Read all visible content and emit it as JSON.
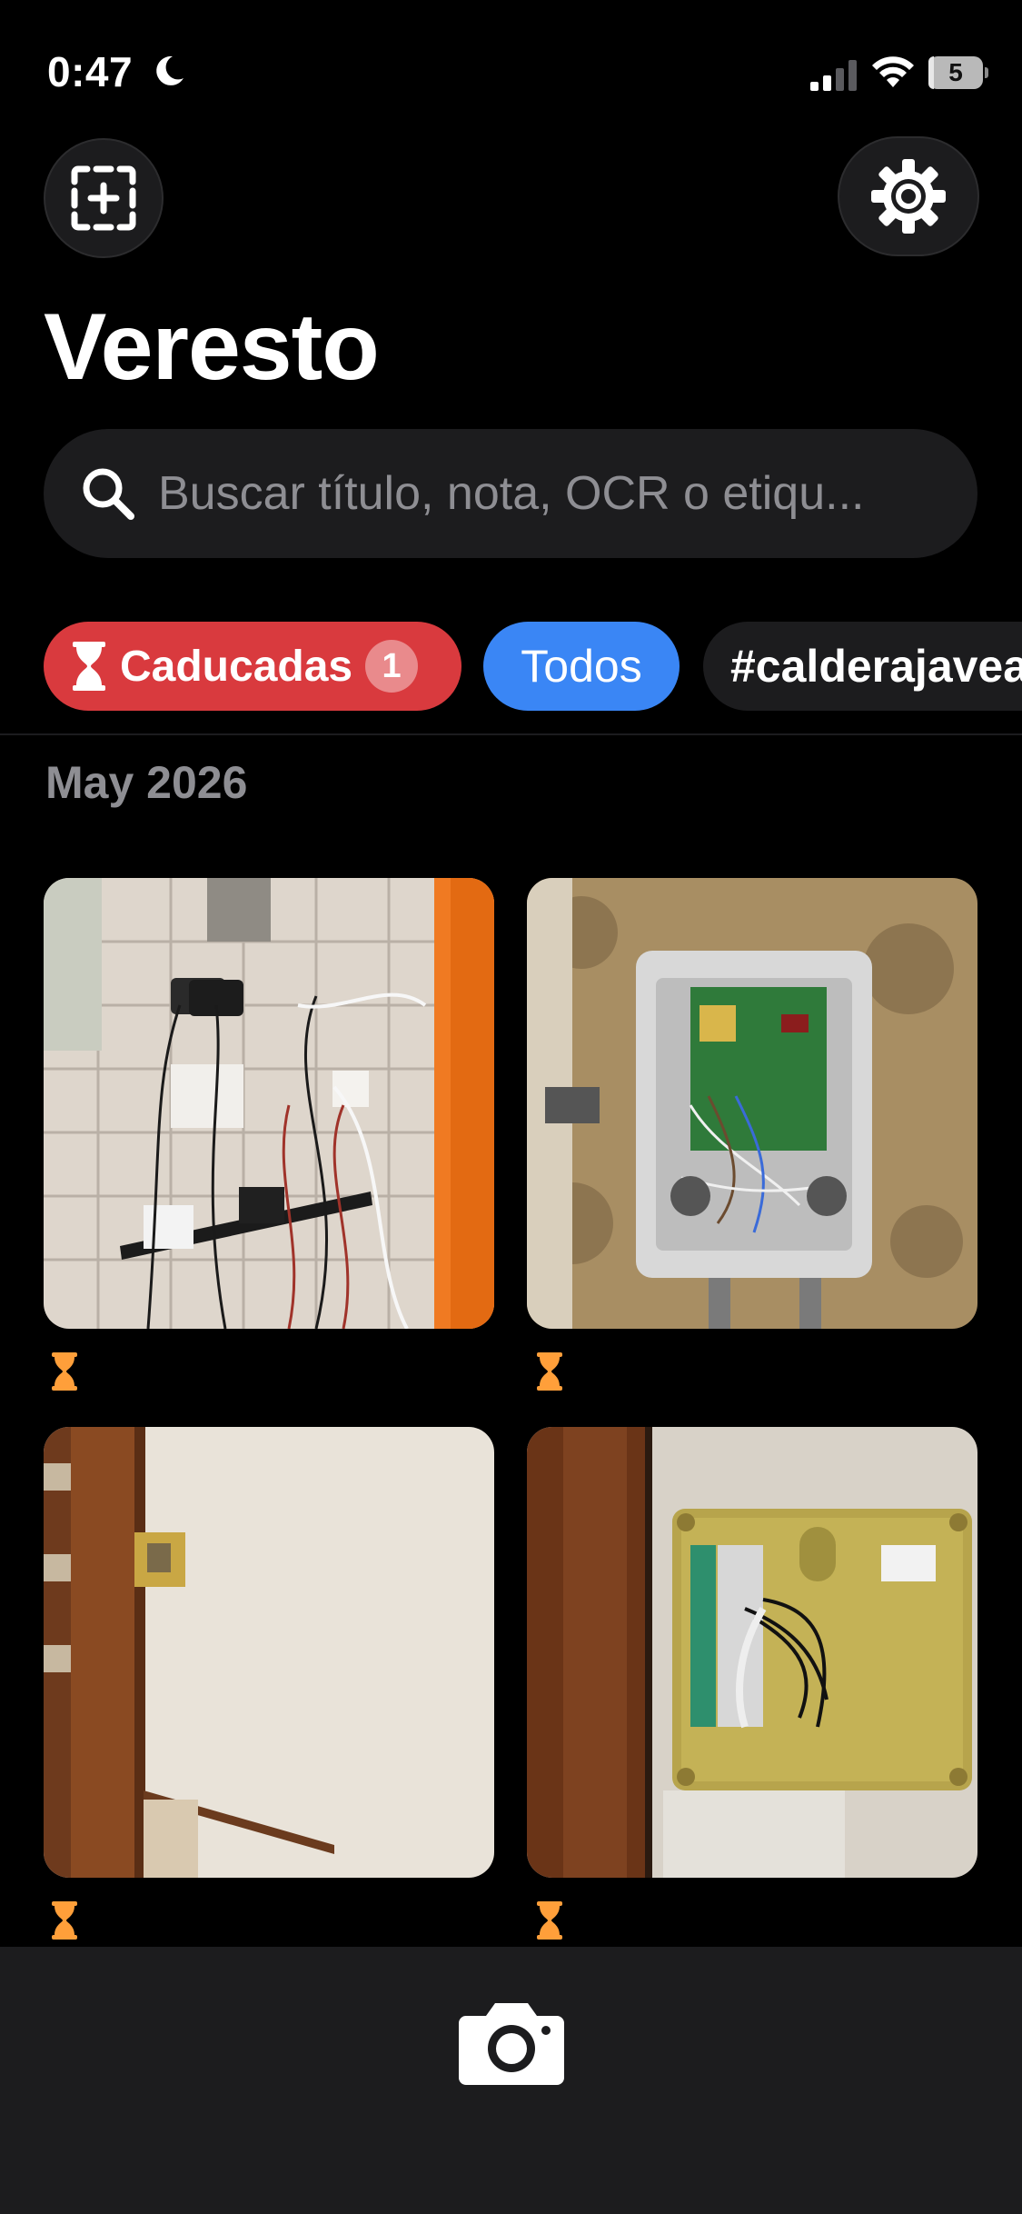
{
  "status_bar": {
    "time": "0:47",
    "battery": "5",
    "battery_level": 0.05,
    "icons": [
      "moon-icon",
      "signal-icon",
      "wifi-icon",
      "battery-icon"
    ]
  },
  "header": {
    "title": "Veresto",
    "left_button_icon": "add-frame-icon",
    "right_button_icon": "gear-icon"
  },
  "search": {
    "placeholder": "Buscar título, nota, OCR o etiqu..."
  },
  "filters": {
    "expired": {
      "label": "Caducadas",
      "count": "1",
      "icon": "hourglass-icon",
      "color": "#d93a3e"
    },
    "all": {
      "label": "Todos",
      "color": "#3a86f5"
    },
    "tag": {
      "label": "#calderajavea"
    }
  },
  "section": {
    "title": "May 2026"
  },
  "photos": [
    {
      "subject": "wall with chargers and cables",
      "status_icon": "hourglass-icon"
    },
    {
      "subject": "open electrical control board on stone wall",
      "status_icon": "hourglass-icon"
    },
    {
      "subject": "wall mounted switch near door",
      "status_icon": "hourglass-icon"
    },
    {
      "subject": "metal mounting plate with wiring",
      "status_icon": "hourglass-icon"
    }
  ],
  "colors": {
    "accent_orange": "#ff9f3a",
    "background": "#000000",
    "surface": "#1c1c1e"
  },
  "bottom_bar": {
    "camera_icon": "camera-icon"
  }
}
